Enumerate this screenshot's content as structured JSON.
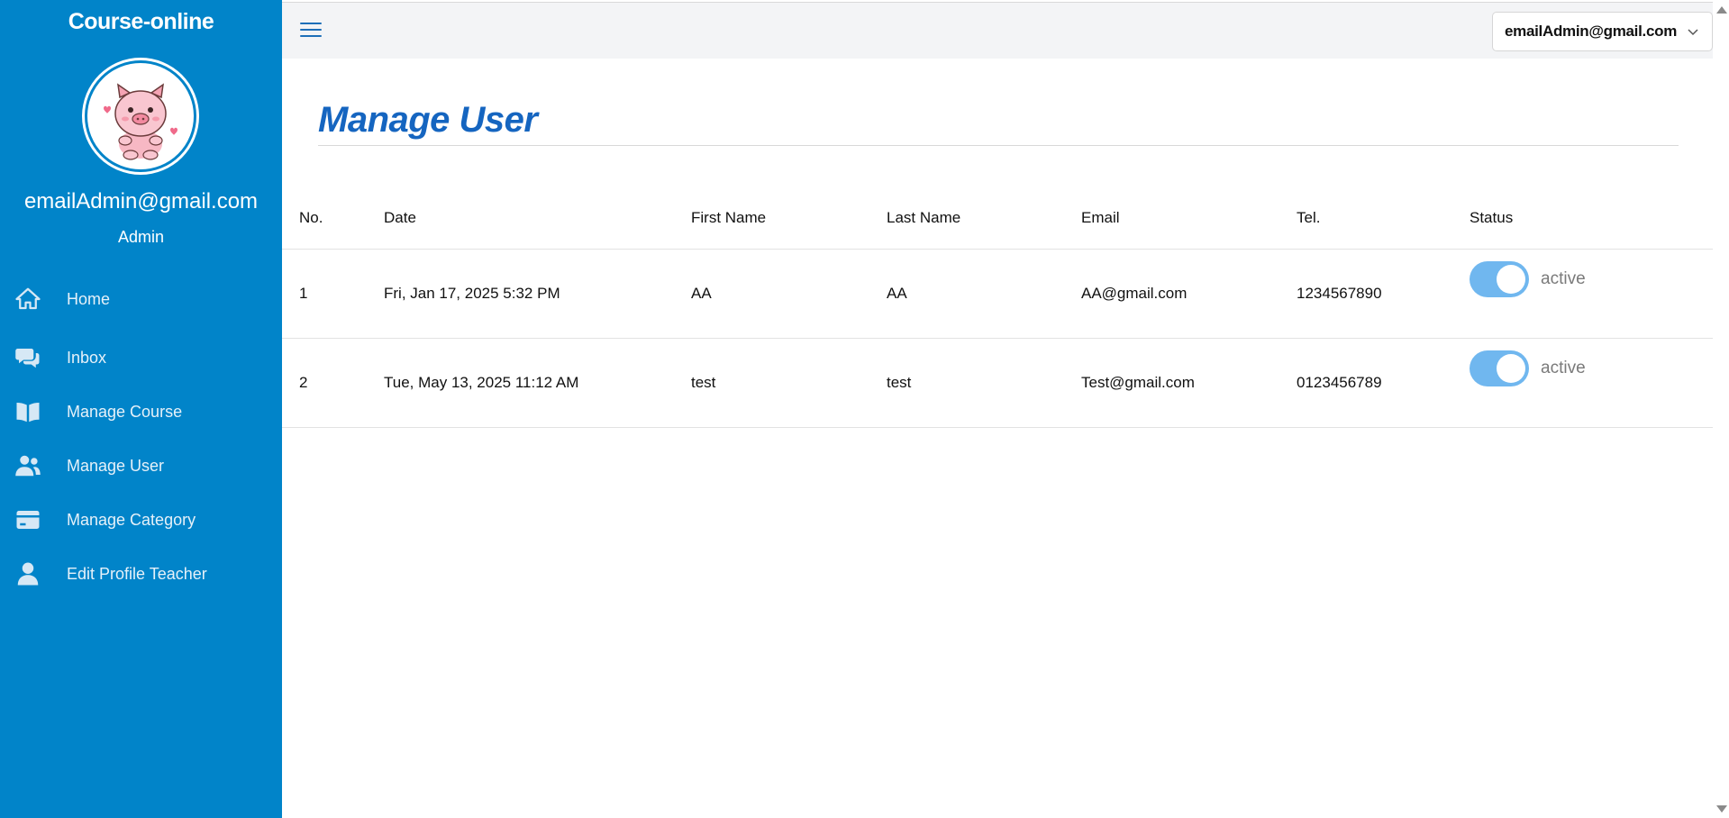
{
  "sidebar": {
    "brand": "Course-online",
    "user_email": "emailAdmin@gmail.com",
    "user_role": "Admin",
    "items": [
      {
        "label": "Home",
        "icon": "home-icon"
      },
      {
        "label": "Inbox",
        "icon": "chat-bubbles-icon"
      },
      {
        "label": "Manage Course",
        "icon": "open-book-icon"
      },
      {
        "label": "Manage User",
        "icon": "users-icon"
      },
      {
        "label": "Manage Category",
        "icon": "card-icon"
      },
      {
        "label": "Edit Profile Teacher",
        "icon": "user-icon"
      }
    ]
  },
  "topbar": {
    "account_label": "emailAdmin@gmail.com"
  },
  "main": {
    "title": "Manage User",
    "table": {
      "headers": [
        "No.",
        "Date",
        "First Name",
        "Last Name",
        "Email",
        "Tel.",
        "Status"
      ],
      "rows": [
        {
          "no": "1",
          "date": "Fri, Jan 17, 2025 5:32 PM",
          "first_name": "AA",
          "last_name": "AA",
          "email": "AA@gmail.com",
          "tel": "1234567890",
          "status": "active",
          "status_on": true
        },
        {
          "no": "2",
          "date": "Tue, May 13, 2025 11:12 AM",
          "first_name": "test",
          "last_name": "test",
          "email": "Test@gmail.com",
          "tel": "0123456789",
          "status": "active",
          "status_on": true
        }
      ]
    }
  },
  "colors": {
    "sidebar_bg": "#0184c9",
    "title": "#1565c0",
    "toggle_on": "#70b7ef"
  }
}
